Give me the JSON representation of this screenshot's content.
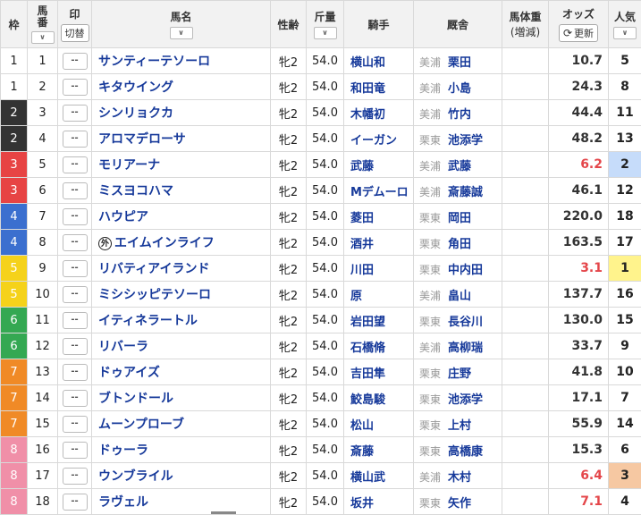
{
  "header": {
    "waku": "枠",
    "umaban": "馬番",
    "mark": "印",
    "mark_toggle": "切替",
    "name": "馬名",
    "sexage": "性齢",
    "kinryo": "斤量",
    "jockey": "騎手",
    "stable": "厩舎",
    "weight_line1": "馬体重",
    "weight_line2": "(増減)",
    "odds": "オッズ",
    "refresh": "更新",
    "popularity": "人気",
    "sort_icon": "chevron-down-icon"
  },
  "colors": {
    "link_blue": "#16399a",
    "odds_hot": "#e4464a",
    "pop1": "#fff38c",
    "pop2": "#c6dcfa",
    "pop3": "#f6c8a2"
  },
  "rows": [
    {
      "waku": "1",
      "num": "1",
      "mark": "--",
      "name": "サンティーテソーロ",
      "sexage": "牝2",
      "kin": "54.0",
      "jockey": "横山和",
      "region": "美浦",
      "trainer": "栗田",
      "weight": "",
      "odds": "10.7",
      "pop": "5"
    },
    {
      "waku": "1",
      "num": "2",
      "mark": "--",
      "name": "キタウイング",
      "sexage": "牝2",
      "kin": "54.0",
      "jockey": "和田竜",
      "region": "美浦",
      "trainer": "小島",
      "weight": "",
      "odds": "24.3",
      "pop": "8"
    },
    {
      "waku": "2",
      "num": "3",
      "mark": "--",
      "name": "シンリョクカ",
      "sexage": "牝2",
      "kin": "54.0",
      "jockey": "木幡初",
      "region": "美浦",
      "trainer": "竹内",
      "weight": "",
      "odds": "44.4",
      "pop": "11"
    },
    {
      "waku": "2",
      "num": "4",
      "mark": "--",
      "name": "アロマデローサ",
      "sexage": "牝2",
      "kin": "54.0",
      "jockey": "イーガン",
      "region": "栗東",
      "trainer": "池添学",
      "weight": "",
      "odds": "48.2",
      "pop": "13"
    },
    {
      "waku": "3",
      "num": "5",
      "mark": "--",
      "name": "モリアーナ",
      "sexage": "牝2",
      "kin": "54.0",
      "jockey": "武藤",
      "region": "美浦",
      "trainer": "武藤",
      "weight": "",
      "odds": "6.2",
      "pop": "2"
    },
    {
      "waku": "3",
      "num": "6",
      "mark": "--",
      "name": "ミスヨコハマ",
      "sexage": "牝2",
      "kin": "54.0",
      "jockey": "Mデムーロ",
      "region": "美浦",
      "trainer": "斎藤誠",
      "weight": "",
      "odds": "46.1",
      "pop": "12"
    },
    {
      "waku": "4",
      "num": "7",
      "mark": "--",
      "name": "ハウピア",
      "sexage": "牝2",
      "kin": "54.0",
      "jockey": "菱田",
      "region": "栗東",
      "trainer": "岡田",
      "weight": "",
      "odds": "220.0",
      "pop": "18"
    },
    {
      "waku": "4",
      "num": "8",
      "mark": "--",
      "name": "エイムインライフ",
      "gai": "外",
      "sexage": "牝2",
      "kin": "54.0",
      "jockey": "酒井",
      "region": "栗東",
      "trainer": "角田",
      "weight": "",
      "odds": "163.5",
      "pop": "17"
    },
    {
      "waku": "5",
      "num": "9",
      "mark": "--",
      "name": "リバティアイランド",
      "sexage": "牝2",
      "kin": "54.0",
      "jockey": "川田",
      "region": "栗東",
      "trainer": "中内田",
      "weight": "",
      "odds": "3.1",
      "pop": "1"
    },
    {
      "waku": "5",
      "num": "10",
      "mark": "--",
      "name": "ミシシッピテソーロ",
      "sexage": "牝2",
      "kin": "54.0",
      "jockey": "原",
      "region": "美浦",
      "trainer": "畠山",
      "weight": "",
      "odds": "137.7",
      "pop": "16"
    },
    {
      "waku": "6",
      "num": "11",
      "mark": "--",
      "name": "イティネラートル",
      "sexage": "牝2",
      "kin": "54.0",
      "jockey": "岩田望",
      "region": "栗東",
      "trainer": "長谷川",
      "weight": "",
      "odds": "130.0",
      "pop": "15"
    },
    {
      "waku": "6",
      "num": "12",
      "mark": "--",
      "name": "リバーラ",
      "sexage": "牝2",
      "kin": "54.0",
      "jockey": "石橋脩",
      "region": "美浦",
      "trainer": "高柳瑞",
      "weight": "",
      "odds": "33.7",
      "pop": "9"
    },
    {
      "waku": "7",
      "num": "13",
      "mark": "--",
      "name": "ドゥアイズ",
      "sexage": "牝2",
      "kin": "54.0",
      "jockey": "吉田隼",
      "region": "栗東",
      "trainer": "庄野",
      "weight": "",
      "odds": "41.8",
      "pop": "10"
    },
    {
      "waku": "7",
      "num": "14",
      "mark": "--",
      "name": "ブトンドール",
      "sexage": "牝2",
      "kin": "54.0",
      "jockey": "鮫島駿",
      "region": "栗東",
      "trainer": "池添学",
      "weight": "",
      "odds": "17.1",
      "pop": "7"
    },
    {
      "waku": "7",
      "num": "15",
      "mark": "--",
      "name": "ムーンプローブ",
      "sexage": "牝2",
      "kin": "54.0",
      "jockey": "松山",
      "region": "栗東",
      "trainer": "上村",
      "weight": "",
      "odds": "55.9",
      "pop": "14"
    },
    {
      "waku": "8",
      "num": "16",
      "mark": "--",
      "name": "ドゥーラ",
      "sexage": "牝2",
      "kin": "54.0",
      "jockey": "斎藤",
      "region": "栗東",
      "trainer": "高橋康",
      "weight": "",
      "odds": "15.3",
      "pop": "6"
    },
    {
      "waku": "8",
      "num": "17",
      "mark": "--",
      "name": "ウンブライル",
      "sexage": "牝2",
      "kin": "54.0",
      "jockey": "横山武",
      "region": "美浦",
      "trainer": "木村",
      "weight": "",
      "odds": "6.4",
      "pop": "3"
    },
    {
      "waku": "8",
      "num": "18",
      "mark": "--",
      "name": "ラヴェル",
      "sexage": "牝2",
      "kin": "54.0",
      "jockey": "坂井",
      "region": "栗東",
      "trainer": "矢作",
      "weight": "",
      "odds": "7.1",
      "pop": "4"
    }
  ]
}
